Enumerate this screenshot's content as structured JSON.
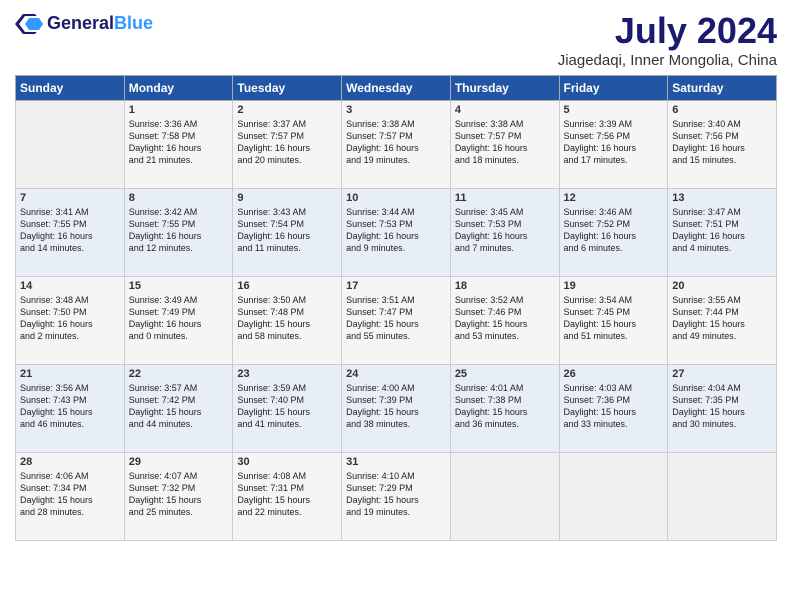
{
  "header": {
    "logo_line1": "General",
    "logo_line2": "Blue",
    "month_title": "July 2024",
    "subtitle": "Jiagedaqi, Inner Mongolia, China"
  },
  "days_of_week": [
    "Sunday",
    "Monday",
    "Tuesday",
    "Wednesday",
    "Thursday",
    "Friday",
    "Saturday"
  ],
  "weeks": [
    [
      {
        "day": "",
        "content": ""
      },
      {
        "day": "1",
        "content": "Sunrise: 3:36 AM\nSunset: 7:58 PM\nDaylight: 16 hours\nand 21 minutes."
      },
      {
        "day": "2",
        "content": "Sunrise: 3:37 AM\nSunset: 7:57 PM\nDaylight: 16 hours\nand 20 minutes."
      },
      {
        "day": "3",
        "content": "Sunrise: 3:38 AM\nSunset: 7:57 PM\nDaylight: 16 hours\nand 19 minutes."
      },
      {
        "day": "4",
        "content": "Sunrise: 3:38 AM\nSunset: 7:57 PM\nDaylight: 16 hours\nand 18 minutes."
      },
      {
        "day": "5",
        "content": "Sunrise: 3:39 AM\nSunset: 7:56 PM\nDaylight: 16 hours\nand 17 minutes."
      },
      {
        "day": "6",
        "content": "Sunrise: 3:40 AM\nSunset: 7:56 PM\nDaylight: 16 hours\nand 15 minutes."
      }
    ],
    [
      {
        "day": "7",
        "content": "Sunrise: 3:41 AM\nSunset: 7:55 PM\nDaylight: 16 hours\nand 14 minutes."
      },
      {
        "day": "8",
        "content": "Sunrise: 3:42 AM\nSunset: 7:55 PM\nDaylight: 16 hours\nand 12 minutes."
      },
      {
        "day": "9",
        "content": "Sunrise: 3:43 AM\nSunset: 7:54 PM\nDaylight: 16 hours\nand 11 minutes."
      },
      {
        "day": "10",
        "content": "Sunrise: 3:44 AM\nSunset: 7:53 PM\nDaylight: 16 hours\nand 9 minutes."
      },
      {
        "day": "11",
        "content": "Sunrise: 3:45 AM\nSunset: 7:53 PM\nDaylight: 16 hours\nand 7 minutes."
      },
      {
        "day": "12",
        "content": "Sunrise: 3:46 AM\nSunset: 7:52 PM\nDaylight: 16 hours\nand 6 minutes."
      },
      {
        "day": "13",
        "content": "Sunrise: 3:47 AM\nSunset: 7:51 PM\nDaylight: 16 hours\nand 4 minutes."
      }
    ],
    [
      {
        "day": "14",
        "content": "Sunrise: 3:48 AM\nSunset: 7:50 PM\nDaylight: 16 hours\nand 2 minutes."
      },
      {
        "day": "15",
        "content": "Sunrise: 3:49 AM\nSunset: 7:49 PM\nDaylight: 16 hours\nand 0 minutes."
      },
      {
        "day": "16",
        "content": "Sunrise: 3:50 AM\nSunset: 7:48 PM\nDaylight: 15 hours\nand 58 minutes."
      },
      {
        "day": "17",
        "content": "Sunrise: 3:51 AM\nSunset: 7:47 PM\nDaylight: 15 hours\nand 55 minutes."
      },
      {
        "day": "18",
        "content": "Sunrise: 3:52 AM\nSunset: 7:46 PM\nDaylight: 15 hours\nand 53 minutes."
      },
      {
        "day": "19",
        "content": "Sunrise: 3:54 AM\nSunset: 7:45 PM\nDaylight: 15 hours\nand 51 minutes."
      },
      {
        "day": "20",
        "content": "Sunrise: 3:55 AM\nSunset: 7:44 PM\nDaylight: 15 hours\nand 49 minutes."
      }
    ],
    [
      {
        "day": "21",
        "content": "Sunrise: 3:56 AM\nSunset: 7:43 PM\nDaylight: 15 hours\nand 46 minutes."
      },
      {
        "day": "22",
        "content": "Sunrise: 3:57 AM\nSunset: 7:42 PM\nDaylight: 15 hours\nand 44 minutes."
      },
      {
        "day": "23",
        "content": "Sunrise: 3:59 AM\nSunset: 7:40 PM\nDaylight: 15 hours\nand 41 minutes."
      },
      {
        "day": "24",
        "content": "Sunrise: 4:00 AM\nSunset: 7:39 PM\nDaylight: 15 hours\nand 38 minutes."
      },
      {
        "day": "25",
        "content": "Sunrise: 4:01 AM\nSunset: 7:38 PM\nDaylight: 15 hours\nand 36 minutes."
      },
      {
        "day": "26",
        "content": "Sunrise: 4:03 AM\nSunset: 7:36 PM\nDaylight: 15 hours\nand 33 minutes."
      },
      {
        "day": "27",
        "content": "Sunrise: 4:04 AM\nSunset: 7:35 PM\nDaylight: 15 hours\nand 30 minutes."
      }
    ],
    [
      {
        "day": "28",
        "content": "Sunrise: 4:06 AM\nSunset: 7:34 PM\nDaylight: 15 hours\nand 28 minutes."
      },
      {
        "day": "29",
        "content": "Sunrise: 4:07 AM\nSunset: 7:32 PM\nDaylight: 15 hours\nand 25 minutes."
      },
      {
        "day": "30",
        "content": "Sunrise: 4:08 AM\nSunset: 7:31 PM\nDaylight: 15 hours\nand 22 minutes."
      },
      {
        "day": "31",
        "content": "Sunrise: 4:10 AM\nSunset: 7:29 PM\nDaylight: 15 hours\nand 19 minutes."
      },
      {
        "day": "",
        "content": ""
      },
      {
        "day": "",
        "content": ""
      },
      {
        "day": "",
        "content": ""
      }
    ]
  ]
}
